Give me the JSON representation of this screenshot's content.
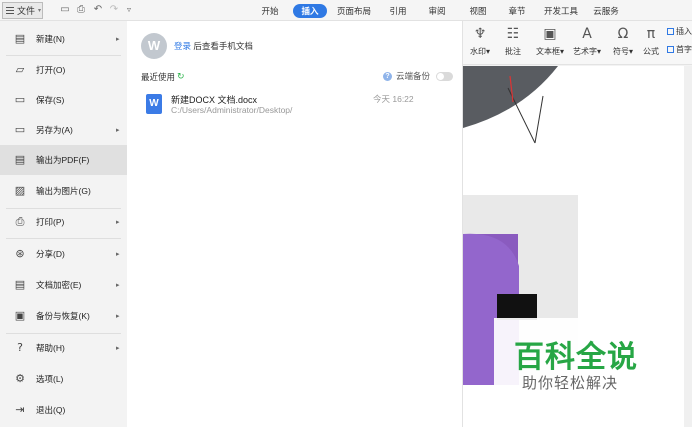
{
  "toolbar": {
    "file_label": "文件",
    "tabs": [
      "开始",
      "插入",
      "页面布局",
      "引用",
      "审阅",
      "视图",
      "章节",
      "开发工具",
      "云服务"
    ],
    "active_tab": "插入"
  },
  "ribbon": {
    "watermark": "水印",
    "comment": "批注",
    "textbox": "文本框",
    "wordart": "艺术字",
    "symbol": "符号",
    "formula": "公式",
    "side1": "插入",
    "side2": "首字"
  },
  "menu": {
    "items": [
      {
        "label": "新建(N)",
        "icon": "new-icon",
        "arrow": true
      },
      {
        "label": "打开(O)",
        "icon": "open-folder-icon",
        "arrow": false
      },
      {
        "label": "保存(S)",
        "icon": "save-icon",
        "arrow": false
      },
      {
        "label": "另存为(A)",
        "icon": "save-as-icon",
        "arrow": true
      },
      {
        "label": "输出为PDF(F)",
        "icon": "pdf-icon",
        "arrow": false
      },
      {
        "label": "输出为图片(G)",
        "icon": "image-icon",
        "arrow": false
      },
      {
        "label": "打印(P)",
        "icon": "print-icon",
        "arrow": true
      },
      {
        "label": "分享(D)",
        "icon": "share-icon",
        "arrow": true
      },
      {
        "label": "文档加密(E)",
        "icon": "encrypt-icon",
        "arrow": true
      },
      {
        "label": "备份与恢复(K)",
        "icon": "backup-icon",
        "arrow": true
      },
      {
        "label": "帮助(H)",
        "icon": "help-icon",
        "arrow": true
      },
      {
        "label": "选项(L)",
        "icon": "settings-icon",
        "arrow": false
      },
      {
        "label": "退出(Q)",
        "icon": "exit-icon",
        "arrow": false
      }
    ],
    "hovered": "输出为PDF(F)"
  },
  "panel": {
    "login_link": "登录",
    "login_text": "后查看手机文档",
    "recent_title": "最近使用",
    "cloud_backup": "云端备份",
    "recent_files": [
      {
        "name": "新建DOCX 文档.docx",
        "path": "C:/Users/Administrator/Desktop/",
        "time": "今天 16:22"
      }
    ]
  },
  "watermark": {
    "title": "百科全说",
    "subtitle": "助你轻松解决"
  }
}
